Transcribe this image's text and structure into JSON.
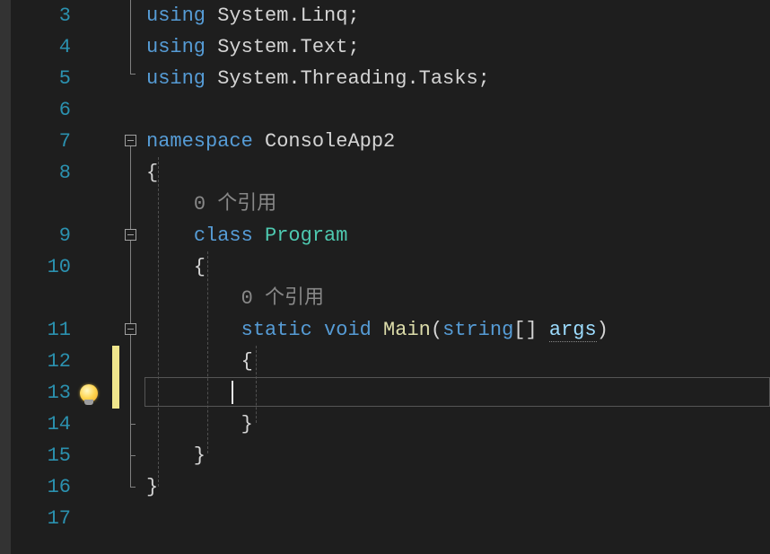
{
  "gutter": {
    "lines": [
      "3",
      "4",
      "5",
      "6",
      "7",
      "8",
      "9",
      "10",
      "11",
      "12",
      "13",
      "14",
      "15",
      "16",
      "17"
    ]
  },
  "codelens": {
    "classRef": "0 个引用",
    "mainRef": "0 个引用"
  },
  "code": {
    "l3_using": "using",
    "l3_ns": " System.Linq;",
    "l4_using": "using",
    "l4_ns": " System.Text;",
    "l5_using": "using",
    "l5_ns": " System.Threading.Tasks;",
    "l7_ns_kw": "namespace",
    "l7_ns_name": " ConsoleApp2",
    "l8_brace": "{",
    "l9_class_kw": "class",
    "l9_class_name": " Program",
    "l10_brace": "    {",
    "l11_static": "static",
    "l11_void": " void",
    "l11_main": " Main",
    "l11_paren_o": "(",
    "l11_string": "string",
    "l11_brackets": "[] ",
    "l11_args": "args",
    "l11_paren_c": ")",
    "l12_brace": "        {",
    "l14_brace": "        }",
    "l15_brace": "    }",
    "l16_brace": "}"
  }
}
